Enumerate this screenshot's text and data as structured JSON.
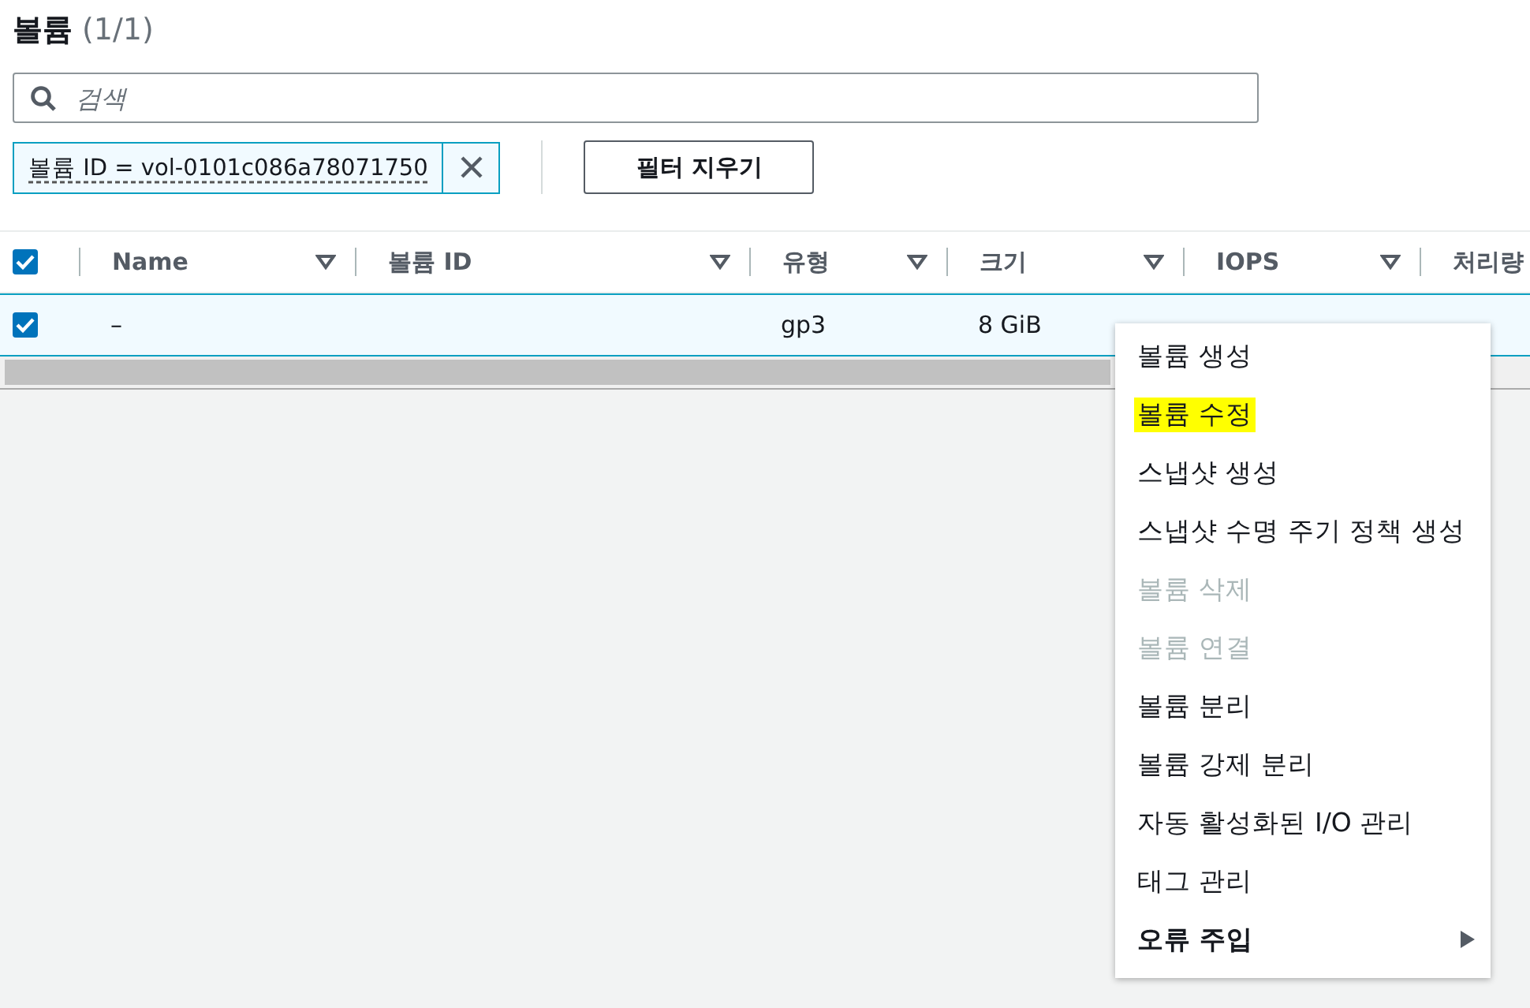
{
  "header": {
    "title": "볼륨",
    "count": "(1/1)"
  },
  "search": {
    "placeholder": "검색"
  },
  "filter_token": {
    "label": "볼륨 ID = vol-0101c086a78071750"
  },
  "clear_button": "필터 지우기",
  "table": {
    "all_checked": true,
    "columns": [
      "Name",
      "볼륨 ID",
      "유형",
      "크기",
      "IOPS",
      "처리량"
    ],
    "rows": [
      {
        "checked": true,
        "cells": [
          "–",
          "",
          "gp3",
          "8 GiB",
          "",
          ""
        ]
      }
    ]
  },
  "context_menu": [
    {
      "label": "볼륨 생성",
      "kind": "item",
      "disabled": false,
      "highlighted": false
    },
    {
      "label": "볼륨 수정",
      "kind": "item",
      "disabled": false,
      "highlighted": true
    },
    {
      "label": "스냅샷 생성",
      "kind": "item",
      "disabled": false,
      "highlighted": false
    },
    {
      "label": "스냅샷 수명 주기 정책 생성",
      "kind": "item",
      "disabled": false,
      "highlighted": false
    },
    {
      "label": "볼륨 삭제",
      "kind": "item",
      "disabled": true,
      "highlighted": false
    },
    {
      "label": "볼륨 연결",
      "kind": "item",
      "disabled": true,
      "highlighted": false
    },
    {
      "label": "볼륨 분리",
      "kind": "item",
      "disabled": false,
      "highlighted": false
    },
    {
      "label": "볼륨 강제 분리",
      "kind": "item",
      "disabled": false,
      "highlighted": false
    },
    {
      "label": "자동 활성화된 I/O 관리",
      "kind": "item",
      "disabled": false,
      "highlighted": false
    },
    {
      "label": "태그 관리",
      "kind": "item",
      "disabled": false,
      "highlighted": false
    },
    {
      "label": "오류 주입",
      "kind": "submenu",
      "disabled": false,
      "highlighted": false
    }
  ]
}
